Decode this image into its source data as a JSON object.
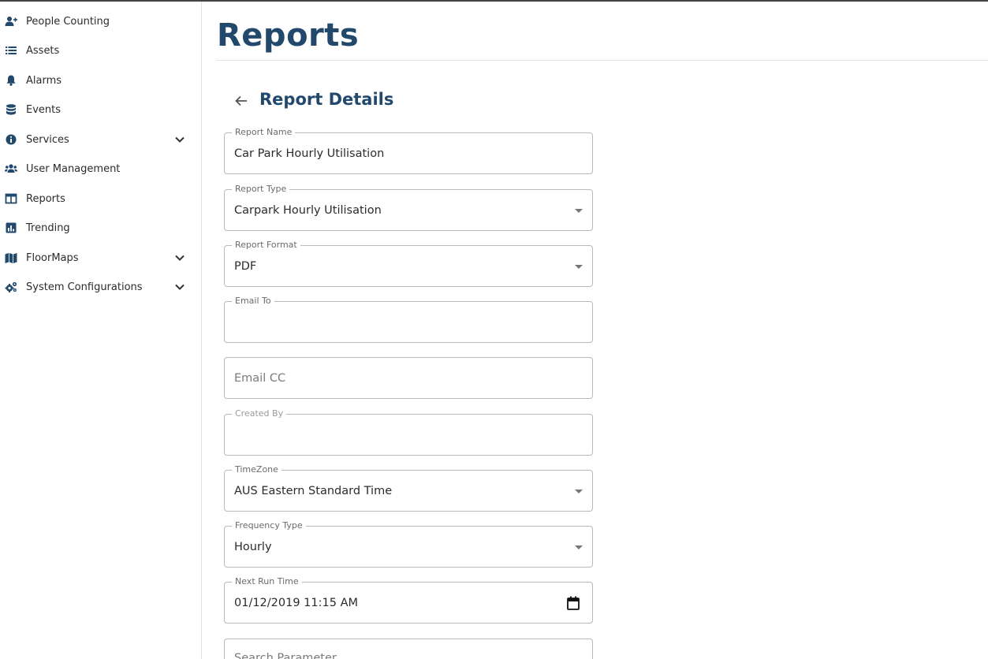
{
  "sidebar": {
    "items": [
      {
        "label": "People Counting",
        "icon": "user-plus-icon",
        "expandable": false
      },
      {
        "label": "Assets",
        "icon": "list-icon",
        "expandable": false
      },
      {
        "label": "Alarms",
        "icon": "bell-icon",
        "expandable": false
      },
      {
        "label": "Events",
        "icon": "database-icon",
        "expandable": false
      },
      {
        "label": "Services",
        "icon": "info-icon",
        "expandable": true
      },
      {
        "label": "User Management",
        "icon": "users-icon",
        "expandable": false
      },
      {
        "label": "Reports",
        "icon": "table-icon",
        "expandable": false
      },
      {
        "label": "Trending",
        "icon": "chart-icon",
        "expandable": false
      },
      {
        "label": "FloorMaps",
        "icon": "map-icon",
        "expandable": true
      },
      {
        "label": "System Configurations",
        "icon": "cogs-icon",
        "expandable": true
      }
    ]
  },
  "header": {
    "title": "Reports"
  },
  "form": {
    "title": "Report Details",
    "fields": {
      "report_name": {
        "label": "Report Name",
        "value": "Car Park Hourly Utilisation"
      },
      "report_type": {
        "label": "Report Type",
        "value": "Carpark Hourly Utilisation"
      },
      "report_format": {
        "label": "Report Format",
        "value": "PDF"
      },
      "email_to": {
        "label": "Email To",
        "value": ""
      },
      "email_cc": {
        "placeholder": "Email CC"
      },
      "created_by": {
        "label": "Created By",
        "value": ""
      },
      "timezone": {
        "label": "TimeZone",
        "value": "AUS Eastern Standard Time"
      },
      "frequency_type": {
        "label": "Frequency Type",
        "value": "Hourly"
      },
      "next_run_time": {
        "label": "Next Run Time",
        "value": "01/12/2019 11:15 AM"
      },
      "search_parameter": {
        "placeholder": "Search Parameter"
      }
    }
  },
  "colors": {
    "brand": "#22496b",
    "text": "#2b2b2b",
    "border": "#b9b9b9"
  }
}
